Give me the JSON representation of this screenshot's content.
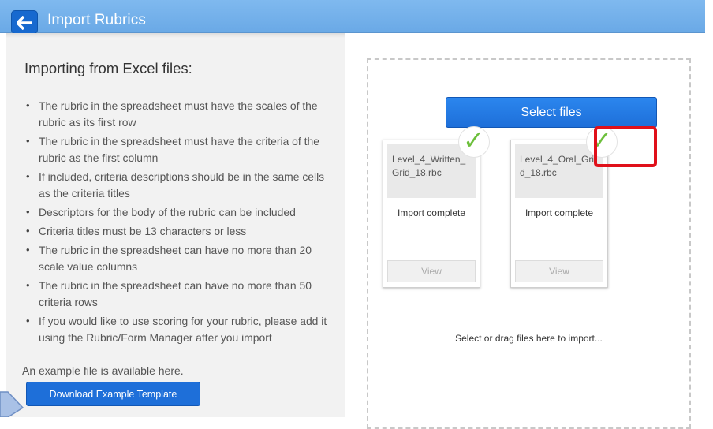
{
  "header": {
    "title": "Import Rubrics",
    "back_icon": "arrow-left-icon",
    "colors": {
      "bar": "#6aa9e6",
      "button": "#1769cf"
    }
  },
  "instructions": {
    "heading": "Importing from Excel files:",
    "bullets": [
      "The rubric in the spreadsheet must have the scales of the rubric as its first row",
      "The rubric in the spreadsheet must have the criteria of the rubric as the first column",
      "If included, criteria descriptions should be in the same cells as the criteria titles",
      "Descriptors for the body of the rubric can be included",
      "Criteria titles must be 13 characters or less",
      "The rubric in the spreadsheet can have no more than 20 scale value columns",
      "The rubric in the spreadsheet can have no more than 50 criteria rows",
      "If you would like to use scoring for your rubric, please add it using the Rubric/Form Manager after you import"
    ],
    "example_text": "An example file is available here.",
    "download_label": "Download Example Template"
  },
  "upload": {
    "select_label": "Select files",
    "drop_hint": "Select or drag files here to import...",
    "files": [
      {
        "name": "Level_4_Written_Grid_18.rbc",
        "status": "Import complete",
        "view_label": "View",
        "check_icon": "checkmark-icon"
      },
      {
        "name": "Level_4_Oral_Grid_18.rbc",
        "status": "Import complete",
        "view_label": "View",
        "check_icon": "checkmark-icon"
      }
    ],
    "colors": {
      "check": "#6cbf3b",
      "highlight": "#e0101a"
    }
  }
}
